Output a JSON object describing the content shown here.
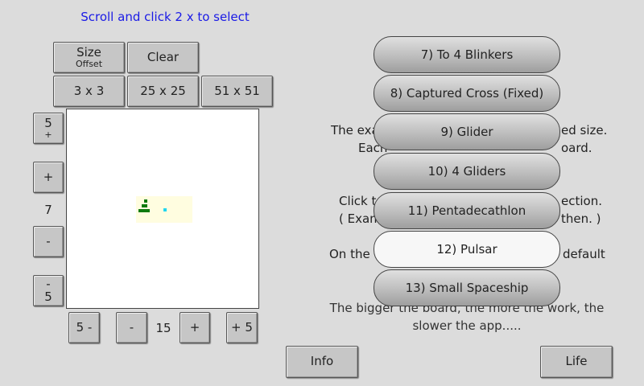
{
  "header": {
    "instruction": "Scroll and click 2 x to select"
  },
  "size_controls": {
    "size_label": "Size",
    "offset_label": "Offset",
    "clear_label": "Clear",
    "presets": [
      "3 x 3",
      "25 x 25",
      "51 x 51"
    ]
  },
  "vertical_controls": {
    "plus5_top": "5",
    "plus5_bottom": "+",
    "plus": "+",
    "value": "7",
    "minus": "-",
    "minus5_top": "-",
    "minus5_bottom": "5"
  },
  "horizontal_controls": {
    "minus5": "5 -",
    "minus": "-",
    "value": "15",
    "plus": "+",
    "plus5": "+ 5"
  },
  "board_colors": {
    "live": "#0f7a0f",
    "marker": "#22d6f0",
    "area": "#fffde0"
  },
  "background_text": {
    "line1a": "The exa",
    "line1b": "ed size.",
    "line2a": "Each",
    "line2b": "oard.",
    "line3a": "Click t",
    "line3b": "ection.",
    "line4a": "( Examp",
    "line4b": "then. )",
    "line5a": "On the",
    "line5b": "default",
    "line6": "The bigger the board, the more the work, the",
    "line7": "slower the app....."
  },
  "pattern_list": [
    {
      "label": "7) To 4 Blinkers",
      "selected": false
    },
    {
      "label": "8) Captured Cross (Fixed)",
      "selected": false
    },
    {
      "label": "9) Glider",
      "selected": false
    },
    {
      "label": "10) 4 Gliders",
      "selected": false
    },
    {
      "label": "11) Pentadecathlon",
      "selected": false
    },
    {
      "label": "12) Pulsar",
      "selected": true
    },
    {
      "label": "13) Small Spaceship",
      "selected": false
    }
  ],
  "footer": {
    "info_label": "Info",
    "life_label": "Life"
  }
}
